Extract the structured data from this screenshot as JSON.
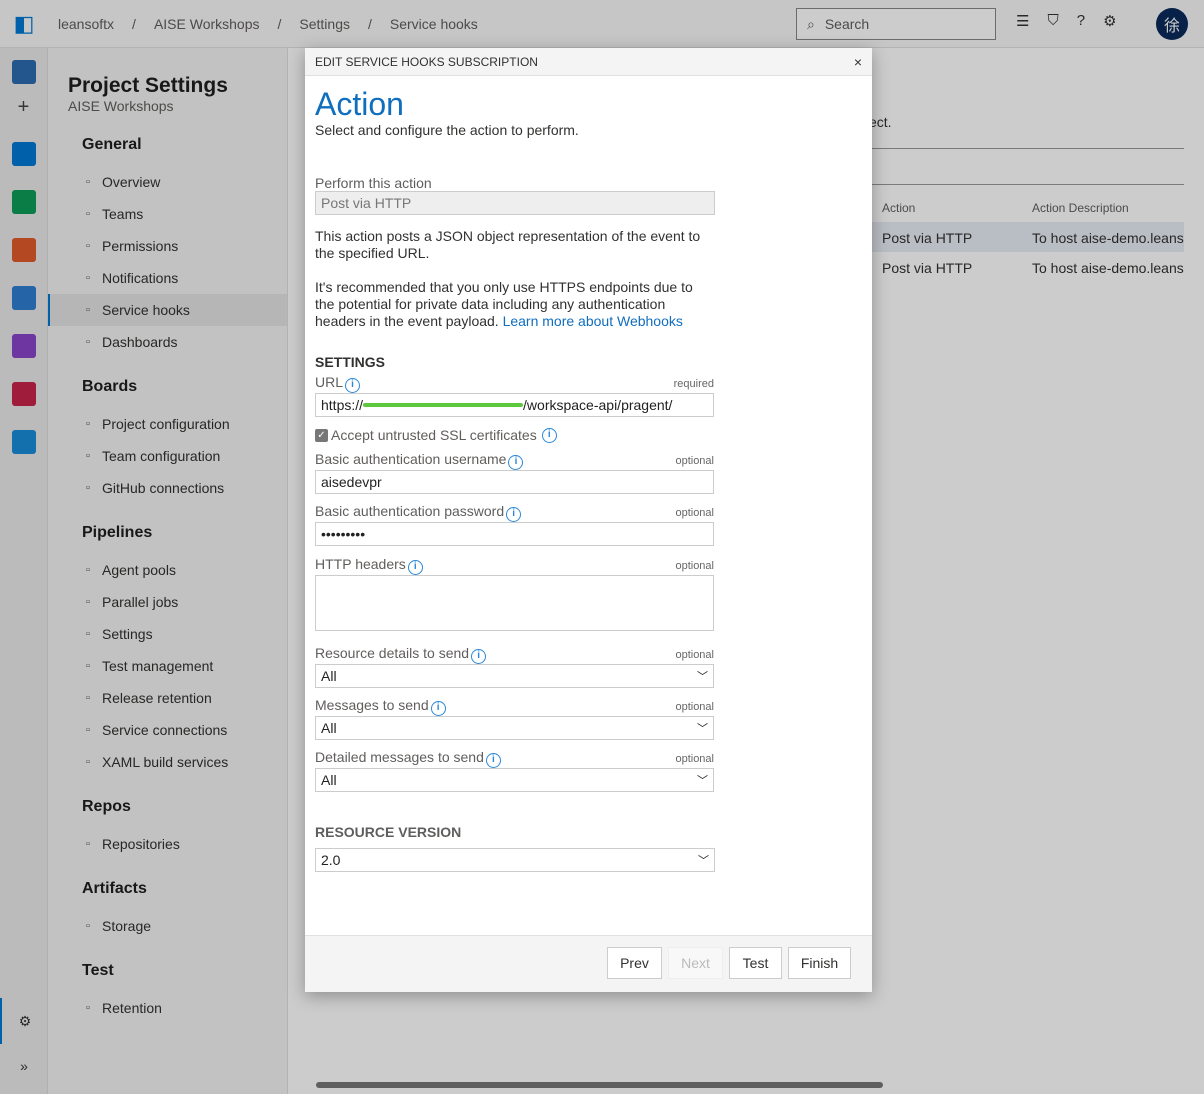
{
  "breadcrumb": [
    "leansoftx",
    "AISE Workshops",
    "Settings",
    "Service hooks"
  ],
  "search": {
    "placeholder": "Search"
  },
  "avatar": "徐",
  "sidebar": {
    "title": "Project Settings",
    "subtitle": "AISE Workshops",
    "groups": [
      {
        "label": "General",
        "items": [
          {
            "label": "Overview",
            "icon": "overview-icon"
          },
          {
            "label": "Teams",
            "icon": "teams-icon"
          },
          {
            "label": "Permissions",
            "icon": "lock-icon"
          },
          {
            "label": "Notifications",
            "icon": "chat-icon"
          },
          {
            "label": "Service hooks",
            "icon": "hook-icon",
            "selected": true
          },
          {
            "label": "Dashboards",
            "icon": "dashboard-icon"
          }
        ]
      },
      {
        "label": "Boards",
        "items": [
          {
            "label": "Project configuration",
            "icon": "config-icon"
          },
          {
            "label": "Team configuration",
            "icon": "team-config-icon"
          },
          {
            "label": "GitHub connections",
            "icon": "github-icon"
          }
        ]
      },
      {
        "label": "Pipelines",
        "items": [
          {
            "label": "Agent pools",
            "icon": "agent-icon"
          },
          {
            "label": "Parallel jobs",
            "icon": "parallel-icon"
          },
          {
            "label": "Settings",
            "icon": "gear-icon"
          },
          {
            "label": "Test management",
            "icon": "test-icon"
          },
          {
            "label": "Release retention",
            "icon": "retention-icon"
          },
          {
            "label": "Service connections",
            "icon": "connection-icon"
          },
          {
            "label": "XAML build services",
            "icon": "build-icon"
          }
        ]
      },
      {
        "label": "Repos",
        "items": [
          {
            "label": "Repositories",
            "icon": "repo-icon"
          }
        ]
      },
      {
        "label": "Artifacts",
        "items": [
          {
            "label": "Storage",
            "icon": "storage-icon"
          }
        ]
      },
      {
        "label": "Test",
        "items": [
          {
            "label": "Retention",
            "icon": "retention-icon"
          }
        ]
      }
    ]
  },
  "background": {
    "text_fragment": "ect.",
    "columns": [
      "Action",
      "Action Description"
    ],
    "rows": [
      [
        "Post via HTTP",
        "To host aise-demo.leans"
      ],
      [
        "Post via HTTP",
        "To host aise-demo.leans"
      ]
    ]
  },
  "dialog": {
    "header": "EDIT SERVICE HOOKS SUBSCRIPTION",
    "close": "×",
    "title": "Action",
    "subtitle": "Select and configure the action to perform.",
    "perform_label": "Perform this action",
    "perform_value": "Post via HTTP",
    "desc1": "This action posts a JSON object representation of the event to the specified URL.",
    "desc2": "It's recommended that you only use HTTPS endpoints due to the potential for private data including any authentication headers in the event payload. ",
    "learn_more": "Learn more about Webhooks",
    "settings_heading": "SETTINGS",
    "url_label": "URL",
    "required": "required",
    "url_prefix": "https://",
    "url_suffix": "/workspace-api/pragent/",
    "ssl_label": "Accept untrusted SSL certificates",
    "ssl_checked": true,
    "user_label": "Basic authentication username",
    "user_value": "aisedevpr",
    "optional": "optional",
    "pass_label": "Basic authentication password",
    "pass_value": "•••••••••",
    "headers_label": "HTTP headers",
    "res_label": "Resource details to send",
    "res_value": "All",
    "msg_label": "Messages to send",
    "msg_value": "All",
    "dmsg_label": "Detailed messages to send",
    "dmsg_value": "All",
    "version_heading": "RESOURCE VERSION",
    "version_value": "2.0",
    "buttons": {
      "prev": "Prev",
      "next": "Next",
      "test": "Test",
      "finish": "Finish"
    }
  }
}
